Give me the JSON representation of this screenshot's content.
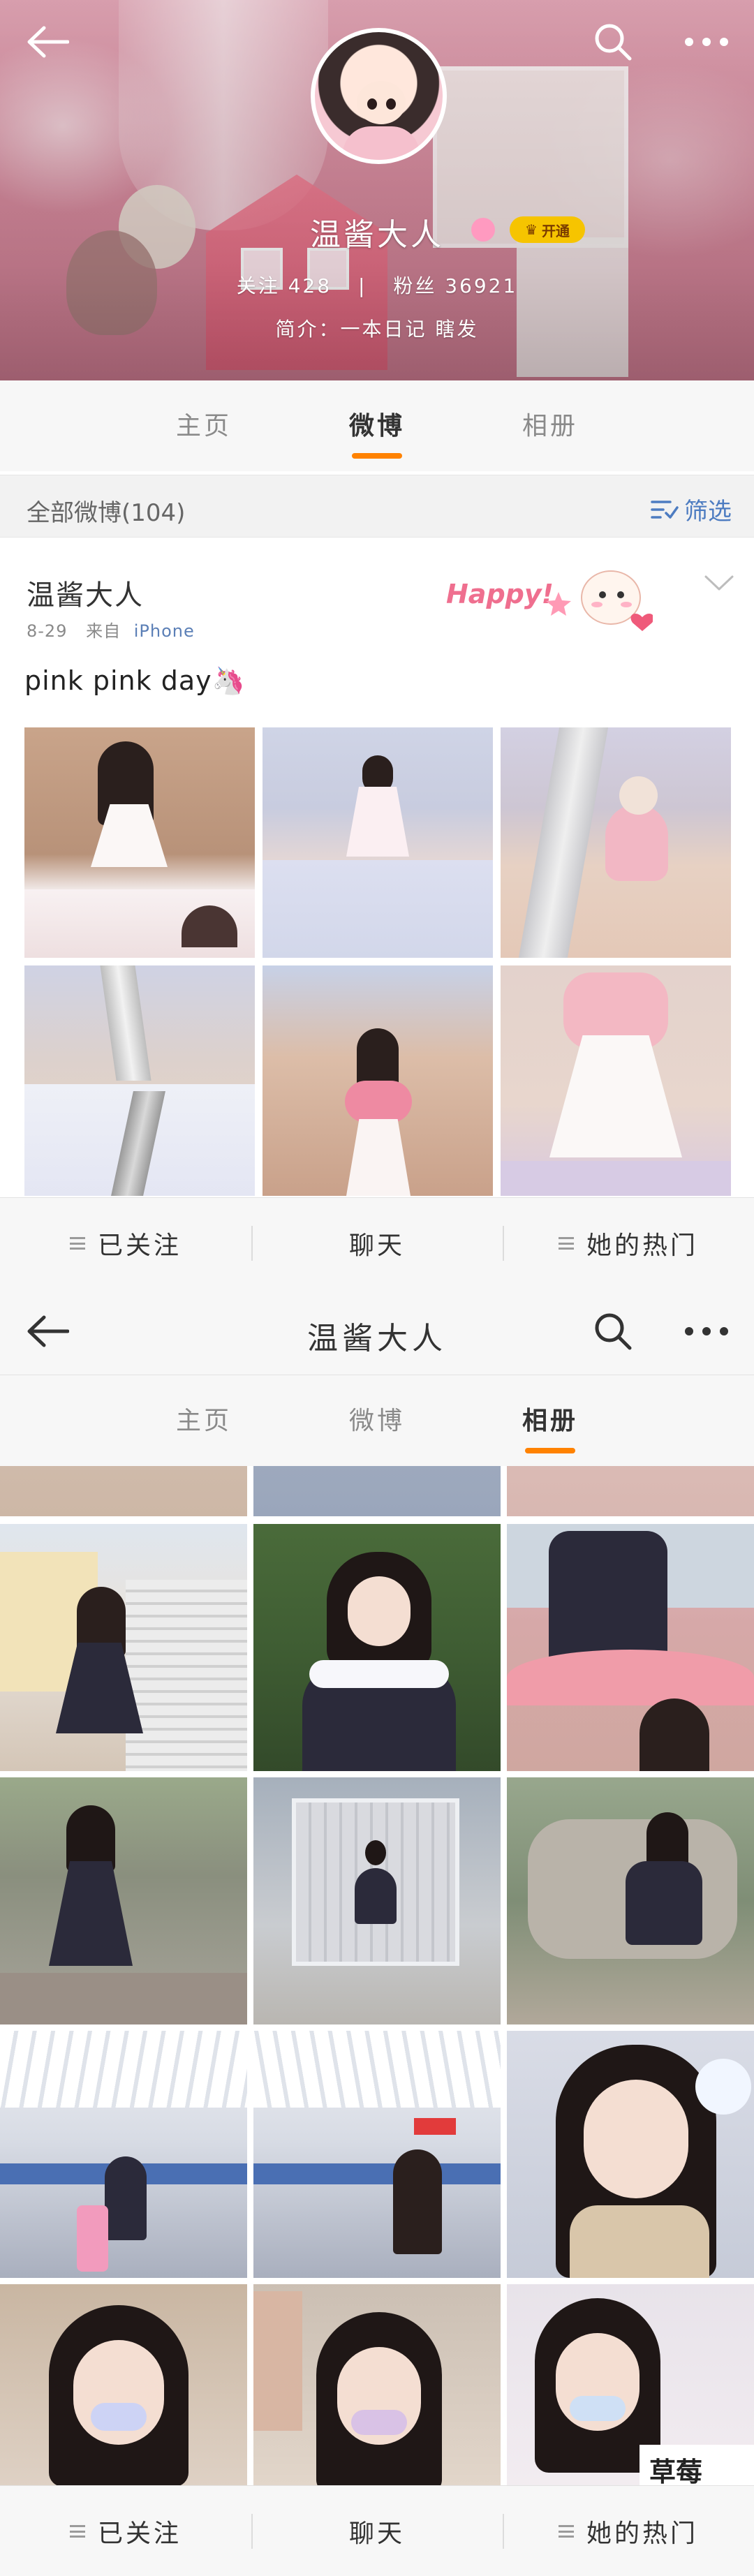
{
  "profile": {
    "name": "温酱大人",
    "vip_label": "开通",
    "following_label": "关注",
    "following_count": "428",
    "followers_label": "粉丝",
    "followers_count": "36921",
    "bio": "简介：一本日记  瞎发"
  },
  "tabs": {
    "home": "主页",
    "weibo": "微博",
    "album": "相册"
  },
  "feed": {
    "count_label": "全部微博(104)",
    "filter_label": "筛选"
  },
  "post": {
    "author": "温酱大人",
    "date": "8-29",
    "from_label": "来自",
    "source": "iPhone",
    "text": "pink  pink  day🦄",
    "sticker_text": "Happy!"
  },
  "actions": {
    "followed": "已关注",
    "chat": "聊天",
    "her_hot": "她的热门"
  },
  "nav2": {
    "title": "温酱大人"
  },
  "album": {
    "caption": "草莓"
  },
  "colors": {
    "accent": "#ff8200",
    "link": "#4d7cc1",
    "vip": "#f6c400"
  }
}
